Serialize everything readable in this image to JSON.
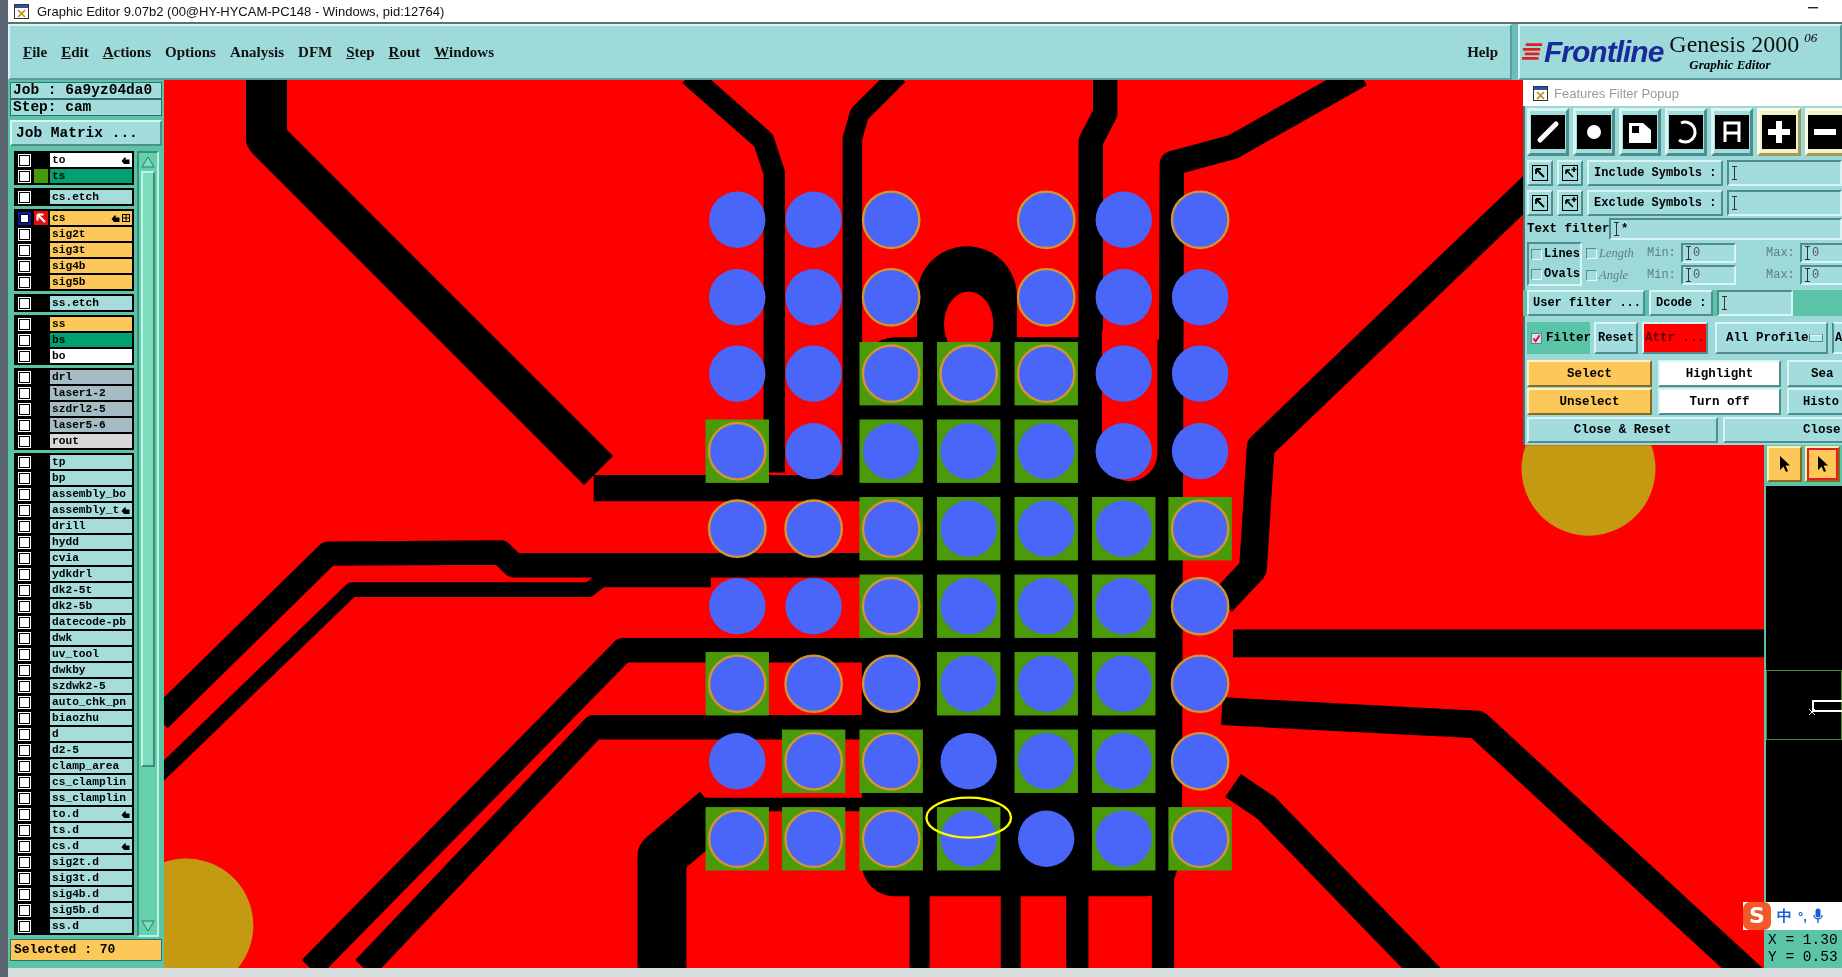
{
  "window": {
    "title": "Graphic Editor 9.07b2 (00@HY-HYCAM-PC148 - Windows, pid:12764)"
  },
  "menu_bar": {
    "items": [
      {
        "label": "File",
        "underlined_initial": true
      },
      {
        "label": "Edit",
        "underlined_initial": true
      },
      {
        "label": "Actions",
        "underlined_initial": true
      },
      {
        "label": "Options",
        "underlined_initial": false
      },
      {
        "label": "Analysis",
        "underlined_initial": false
      },
      {
        "label": "DFM",
        "underlined_initial": false
      },
      {
        "label": "Step",
        "underlined_initial": true
      },
      {
        "label": "Rout",
        "underlined_initial": true
      },
      {
        "label": "Windows",
        "underlined_initial": true
      }
    ],
    "help": "Help"
  },
  "logo": {
    "brand": "Frontline",
    "product": "Genesis 2000",
    "version": "06",
    "subtitle": "Graphic Editor"
  },
  "layers_panel": {
    "job": "Job : 6a9yz04da0",
    "step": "Step: cam",
    "job_matrix": "Job Matrix ...",
    "groups": [
      {
        "layers": [
          {
            "name": "to",
            "color": "#ffffff",
            "checked": false,
            "affected": true,
            "work_layer": false
          },
          {
            "name": "ts",
            "color": "#00a070",
            "swatch": {
              "color": "#4a9a10"
            },
            "checked": false,
            "affected": false,
            "work_layer": false
          }
        ]
      },
      {
        "layers": [
          {
            "name": "cs.etch",
            "color": "#a6dcdc",
            "checked": false,
            "affected": false,
            "work_layer": false
          }
        ]
      },
      {
        "layers": [
          {
            "name": "cs",
            "color": "#fdc85a",
            "checked": false,
            "affected": true,
            "work_layer": true
          },
          {
            "name": "sig2t",
            "color": "#fdc85a",
            "checked": false,
            "affected": false,
            "work_layer": false
          },
          {
            "name": "sig3t",
            "color": "#fdc85a",
            "checked": false,
            "affected": false,
            "work_layer": false
          },
          {
            "name": "sig4b",
            "color": "#fdc85a",
            "checked": false,
            "affected": false,
            "work_layer": false
          },
          {
            "name": "sig5b",
            "color": "#fdc85a",
            "checked": false,
            "affected": false,
            "work_layer": false
          }
        ]
      },
      {
        "layers": [
          {
            "name": "ss.etch",
            "color": "#a6dcdc",
            "checked": false,
            "affected": false,
            "work_layer": false
          }
        ]
      },
      {
        "layers": [
          {
            "name": "ss",
            "color": "#fdc85a",
            "checked": false,
            "affected": false,
            "work_layer": false
          },
          {
            "name": "bs",
            "color": "#00a070",
            "checked": false,
            "affected": false,
            "work_layer": false
          },
          {
            "name": "bo",
            "color": "#ffffff",
            "checked": false,
            "affected": false,
            "work_layer": false
          }
        ]
      },
      {
        "layers": [
          {
            "name": "drl",
            "color": "#a6bcc4",
            "checked": false,
            "affected": false,
            "work_layer": false
          },
          {
            "name": "laser1-2",
            "color": "#a6bcc4",
            "checked": false,
            "affected": false,
            "work_layer": false
          },
          {
            "name": "szdrl2-5",
            "color": "#a6bcc4",
            "checked": false,
            "affected": false,
            "work_layer": false
          },
          {
            "name": "laser5-6",
            "color": "#a6bcc4",
            "checked": false,
            "affected": false,
            "work_layer": false
          },
          {
            "name": "rout",
            "color": "#d8d8d8",
            "checked": false,
            "affected": false,
            "work_layer": false
          }
        ]
      },
      {
        "layers": [
          {
            "name": "tp",
            "color": "#a6dcdc",
            "checked": false,
            "affected": false,
            "work_layer": false
          },
          {
            "name": "bp",
            "color": "#a6dcdc",
            "checked": false,
            "affected": false,
            "work_layer": false
          },
          {
            "name": "assembly_bo",
            "color": "#a6dcdc",
            "checked": false,
            "affected": false,
            "work_layer": false
          },
          {
            "name": "assembly_t",
            "color": "#a6dcdc",
            "checked": false,
            "affected": true,
            "work_layer": false
          },
          {
            "name": "drill",
            "color": "#a6dcdc",
            "checked": false,
            "affected": false,
            "work_layer": false
          },
          {
            "name": "hydd",
            "color": "#a6dcdc",
            "checked": false,
            "affected": false,
            "work_layer": false
          },
          {
            "name": "cvia",
            "color": "#a6dcdc",
            "checked": false,
            "affected": false,
            "work_layer": false
          },
          {
            "name": "ydkdrl",
            "color": "#a6dcdc",
            "checked": false,
            "affected": false,
            "work_layer": false
          },
          {
            "name": "dk2-5t",
            "color": "#a6dcdc",
            "checked": false,
            "affected": false,
            "work_layer": false
          },
          {
            "name": "dk2-5b",
            "color": "#a6dcdc",
            "checked": false,
            "affected": false,
            "work_layer": false
          },
          {
            "name": "datecode-pb",
            "color": "#a6dcdc",
            "checked": false,
            "affected": false,
            "work_layer": false
          },
          {
            "name": "dwk",
            "color": "#a6dcdc",
            "checked": false,
            "affected": false,
            "work_layer": false
          },
          {
            "name": "uv_tool",
            "color": "#a6dcdc",
            "checked": false,
            "affected": false,
            "work_layer": false
          },
          {
            "name": "dwkby",
            "color": "#a6dcdc",
            "checked": false,
            "affected": false,
            "work_layer": false
          },
          {
            "name": "szdwk2-5",
            "color": "#a6dcdc",
            "checked": false,
            "affected": false,
            "work_layer": false
          },
          {
            "name": "auto_chk_pn",
            "color": "#a6dcdc",
            "checked": false,
            "affected": false,
            "work_layer": false
          },
          {
            "name": "biaozhu",
            "color": "#a6dcdc",
            "checked": false,
            "affected": false,
            "work_layer": false
          },
          {
            "name": "d",
            "color": "#a6dcdc",
            "checked": false,
            "affected": false,
            "work_layer": false
          },
          {
            "name": "d2-5",
            "color": "#a6dcdc",
            "checked": false,
            "affected": false,
            "work_layer": false
          },
          {
            "name": "clamp_area",
            "color": "#a6dcdc",
            "checked": false,
            "affected": false,
            "work_layer": false
          },
          {
            "name": "cs_clamplin",
            "color": "#a6dcdc",
            "checked": false,
            "affected": false,
            "work_layer": false
          },
          {
            "name": "ss_clamplin",
            "color": "#a6dcdc",
            "checked": false,
            "affected": false,
            "work_layer": false
          },
          {
            "name": "to.d",
            "color": "#a6dcdc",
            "checked": false,
            "affected": true,
            "work_layer": false
          },
          {
            "name": "ts.d",
            "color": "#a6dcdc",
            "checked": false,
            "affected": false,
            "work_layer": false
          },
          {
            "name": "cs.d",
            "color": "#a6dcdc",
            "checked": false,
            "affected": true,
            "work_layer": false
          },
          {
            "name": "sig2t.d",
            "color": "#a6dcdc",
            "checked": false,
            "affected": false,
            "work_layer": false
          },
          {
            "name": "sig3t.d",
            "color": "#a6dcdc",
            "checked": false,
            "affected": false,
            "work_layer": false
          },
          {
            "name": "sig4b.d",
            "color": "#a6dcdc",
            "checked": false,
            "affected": false,
            "work_layer": false
          },
          {
            "name": "sig5b.d",
            "color": "#a6dcdc",
            "checked": false,
            "affected": false,
            "work_layer": false
          },
          {
            "name": "ss.d",
            "color": "#a6dcdc",
            "checked": false,
            "affected": false,
            "work_layer": false
          }
        ]
      }
    ],
    "selected_count": "Selected : 70"
  },
  "features_filter": {
    "title": "Features Filter Popup",
    "feature_types": [
      {
        "kind": "line"
      },
      {
        "kind": "pad"
      },
      {
        "kind": "surface"
      },
      {
        "kind": "arc"
      },
      {
        "kind": "text"
      },
      {
        "kind": "positive"
      },
      {
        "kind": "negative"
      }
    ],
    "include_symbols": {
      "label": "Include Symbols :"
    },
    "exclude_symbols": {
      "label": "Exclude Symbols :"
    },
    "text_filter": {
      "label": "Text filter",
      "value": "*"
    },
    "shape_types": [
      {
        "label": "Lines",
        "checked": false
      },
      {
        "label": "Ovals",
        "checked": false
      }
    ],
    "ranges": [
      {
        "label": "Length",
        "checked": false,
        "disabled": true,
        "min_label": "Min:",
        "min": "0",
        "max_label": "Max:",
        "max": "0"
      },
      {
        "label": "Angle",
        "checked": false,
        "disabled": true,
        "min_label": "Min:",
        "min": "0",
        "max_label": "Max:",
        "max": "0"
      }
    ],
    "user_filter": "User filter ...",
    "dcode": {
      "label": "Dcode :"
    },
    "filter": {
      "label": "Filter",
      "checked": true
    },
    "reset": "Reset",
    "attributes": {
      "label": "Attr ...",
      "active": true
    },
    "profile": {
      "label": "All Profile"
    },
    "clipped_button": "A",
    "actions": [
      {
        "label": "Select",
        "kind": "select"
      },
      {
        "label": "Highlight",
        "kind": "highlight"
      },
      {
        "label": "Sea",
        "kind": "plain"
      },
      {
        "label": "Unselect",
        "kind": "select"
      },
      {
        "label": "Turn off",
        "kind": "highlight"
      },
      {
        "label": "Histo",
        "kind": "plain"
      }
    ],
    "close_buttons": [
      "Close & Reset",
      "Close"
    ]
  },
  "right_panel": {
    "pointer_buttons": [
      {
        "selected": false
      },
      {
        "selected": true
      }
    ],
    "coordinates": [
      "X = 1.30",
      "Y = 0.53"
    ]
  },
  "ime_bar": {
    "logo": "S",
    "mode": "中",
    "punctuation": "°,"
  }
}
